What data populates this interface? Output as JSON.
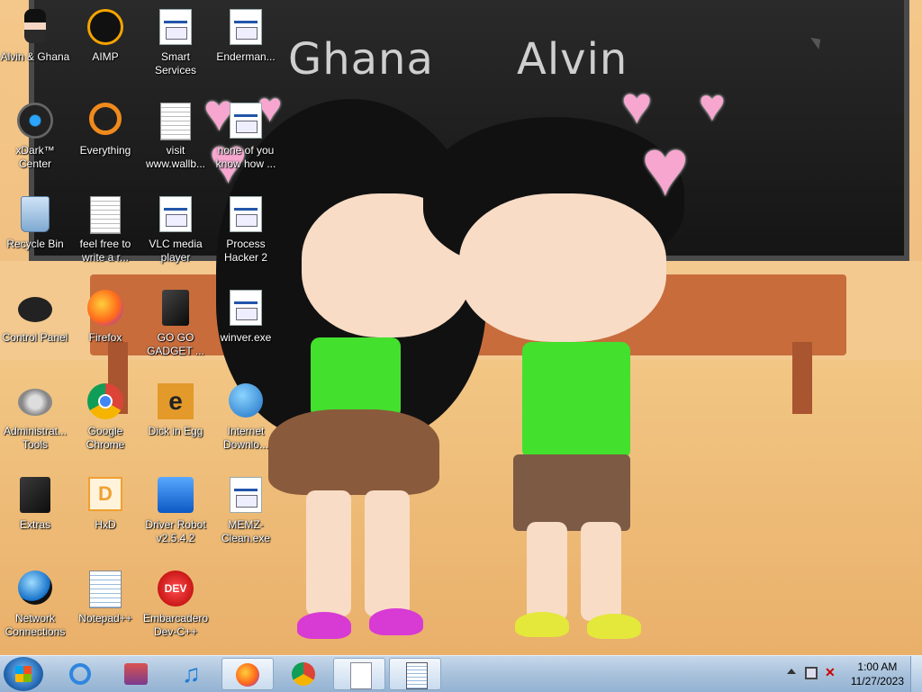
{
  "wallpaper": {
    "text_left": "Ghana",
    "text_right": "Alvin"
  },
  "desktop_icons": [
    {
      "label": "Alvin & Ghana",
      "icon": "character-icon"
    },
    {
      "label": "AIMP",
      "icon": "aimp-icon"
    },
    {
      "label": "Smart Services",
      "icon": "gears-icon"
    },
    {
      "label": "Enderman...",
      "icon": "generic-app-icon"
    },
    {
      "label": "xDark™ Center",
      "icon": "xdark-icon"
    },
    {
      "label": "Everything",
      "icon": "everything-icon"
    },
    {
      "label": "visit www.wallb...",
      "icon": "text-document-icon"
    },
    {
      "label": "none of you know how ...",
      "icon": "generic-app-icon"
    },
    {
      "label": "Recycle Bin",
      "icon": "recycle-bin-icon"
    },
    {
      "label": "feel free to write a r...",
      "icon": "text-document-icon"
    },
    {
      "label": "VLC media player",
      "icon": "vlc-icon"
    },
    {
      "label": "Process Hacker 2",
      "icon": "process-hacker-icon"
    },
    {
      "label": "Control Panel",
      "icon": "control-panel-icon"
    },
    {
      "label": "Firefox",
      "icon": "firefox-icon"
    },
    {
      "label": "GO GO GADGET ...",
      "icon": "gadget-icon"
    },
    {
      "label": "winver.exe",
      "icon": "windows-icon"
    },
    {
      "label": "Administrat... Tools",
      "icon": "admin-tools-icon"
    },
    {
      "label": "Google Chrome",
      "icon": "chrome-icon"
    },
    {
      "label": "Dick in Egg",
      "icon": "app-icon"
    },
    {
      "label": "Internet Downlo...",
      "icon": "globe-download-icon"
    },
    {
      "label": "Extras",
      "icon": "folder-dark-icon"
    },
    {
      "label": "HxD",
      "icon": "hxd-icon"
    },
    {
      "label": "Driver Robot v2.5.4.2",
      "icon": "driver-robot-icon"
    },
    {
      "label": "MEMZ-Clean.exe",
      "icon": "memz-icon"
    },
    {
      "label": "Network Connections",
      "icon": "network-icon"
    },
    {
      "label": "Notepad++",
      "icon": "notepad-plus-icon"
    },
    {
      "label": "Embarcadero Dev-C++",
      "icon": "devcpp-icon"
    }
  ],
  "taskbar": {
    "pinned": [
      {
        "name": "internet-explorer",
        "icon": "ie-icon"
      },
      {
        "name": "media-center",
        "icon": "media-icon"
      },
      {
        "name": "music",
        "icon": "music-note-icon"
      },
      {
        "name": "firefox",
        "icon": "firefox-icon"
      },
      {
        "name": "chrome",
        "icon": "chrome-icon"
      },
      {
        "name": "generic-app",
        "icon": "generic-app-icon"
      },
      {
        "name": "notepad",
        "icon": "notepad-icon"
      }
    ],
    "clock_time": "1:00 AM",
    "clock_date": "11/27/2023",
    "accent": "#1b5ea8"
  }
}
